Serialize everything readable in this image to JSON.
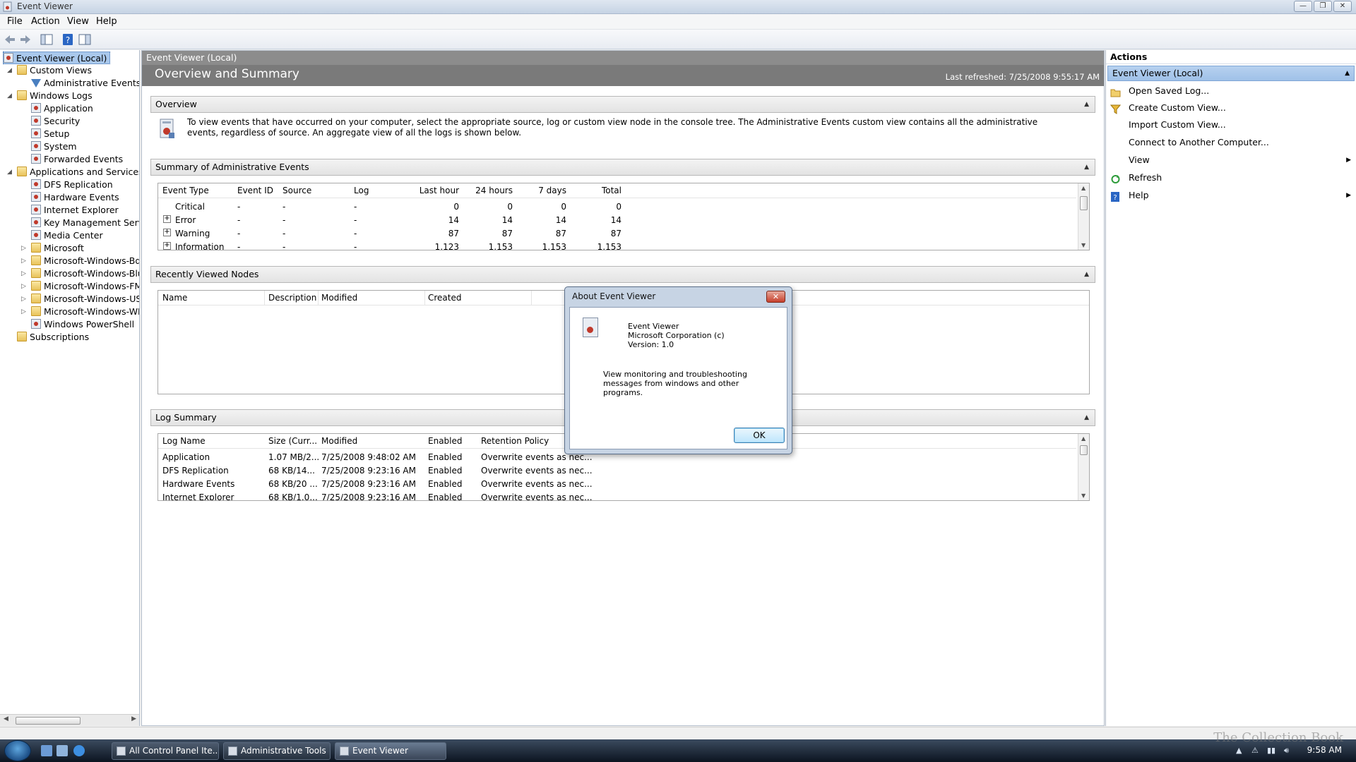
{
  "window": {
    "title": "Event Viewer",
    "buttons": {
      "minimize": "—",
      "maximize": "❐",
      "close": "✕"
    }
  },
  "menu": [
    "File",
    "Action",
    "View",
    "Help"
  ],
  "tree": {
    "root": "Event Viewer (Local)",
    "custom_views": "Custom Views",
    "administrative_events": "Administrative Events",
    "windows_logs": "Windows Logs",
    "windows_logs_items": [
      "Application",
      "Security",
      "Setup",
      "System",
      "Forwarded Events"
    ],
    "apps_services": "Applications and Services Lo",
    "apps_items": [
      "DFS Replication",
      "Hardware Events",
      "Internet Explorer",
      "Key Management Service",
      "Media Center"
    ],
    "folders": [
      "Microsoft",
      "Microsoft-Windows-Bde",
      "Microsoft-Windows-Blue",
      "Microsoft-Windows-FMS",
      "Microsoft-Windows-USP",
      "Microsoft-Windows-WPI"
    ],
    "powershell": "Windows PowerShell",
    "subscriptions": "Subscriptions"
  },
  "center": {
    "header": "Event Viewer (Local)",
    "title": "Overview and Summary",
    "last_refreshed": "Last refreshed: 7/25/2008 9:55:17 AM",
    "overview": {
      "heading": "Overview",
      "text": "To view events that have occurred on your computer, select the appropriate source, log or custom view node in the console tree. The Administrative Events custom view contains all the administrative events, regardless of source. An aggregate view of all the logs is shown below."
    },
    "summary": {
      "heading": "Summary of Administrative Events",
      "columns": [
        "Event Type",
        "Event ID",
        "Source",
        "Log",
        "Last hour",
        "24 hours",
        "7 days",
        "Total"
      ],
      "rows": [
        [
          "Critical",
          "-",
          "-",
          "-",
          "0",
          "0",
          "0",
          "0"
        ],
        [
          "Error",
          "-",
          "-",
          "-",
          "14",
          "14",
          "14",
          "14"
        ],
        [
          "Warning",
          "-",
          "-",
          "-",
          "87",
          "87",
          "87",
          "87"
        ],
        [
          "Information",
          "-",
          "-",
          "-",
          "1,123",
          "1,153",
          "1,153",
          "1,153"
        ]
      ]
    },
    "recent": {
      "heading": "Recently Viewed Nodes",
      "columns": [
        "Name",
        "Description",
        "Modified",
        "Created"
      ]
    },
    "log_summary": {
      "heading": "Log Summary",
      "columns": [
        "Log Name",
        "Size (Curr...",
        "Modified",
        "Enabled",
        "Retention Policy"
      ],
      "rows": [
        [
          "Application",
          "1.07 MB/2...",
          "7/25/2008 9:48:02 AM",
          "Enabled",
          "Overwrite events as nec..."
        ],
        [
          "DFS Replication",
          "68 KB/14...",
          "7/25/2008 9:23:16 AM",
          "Enabled",
          "Overwrite events as nec..."
        ],
        [
          "Hardware Events",
          "68 KB/20 ...",
          "7/25/2008 9:23:16 AM",
          "Enabled",
          "Overwrite events as nec..."
        ],
        [
          "Internet Explorer",
          "68 KB/1.0...",
          "7/25/2008 9:23:16 AM",
          "Enabled",
          "Overwrite events as nec..."
        ]
      ]
    }
  },
  "actions": {
    "heading": "Actions",
    "subheading": "Event Viewer (Local)",
    "items": [
      "Open Saved Log...",
      "Create Custom View...",
      "Import Custom View...",
      "Connect to Another Computer...",
      "View",
      "Refresh",
      "Help"
    ]
  },
  "dialog": {
    "title": "About Event Viewer",
    "close": "✕",
    "product": "Event Viewer",
    "company": "Microsoft Corporation (c)",
    "version": "Version: 1.0",
    "description": "View monitoring and troubleshooting messages from windows and other programs.",
    "ok": "OK"
  },
  "taskbar": {
    "tasks": [
      "All Control Panel Ite...",
      "Administrative Tools",
      "Event Viewer"
    ],
    "clock": "9:58 AM"
  },
  "watermark": "The Collection Book",
  "colors": {
    "selection": "#a9c8ec",
    "header_gray": "#8c8c8c",
    "band_gray": "#7a7a7a",
    "dialog_frame": "#c7d4e4"
  }
}
